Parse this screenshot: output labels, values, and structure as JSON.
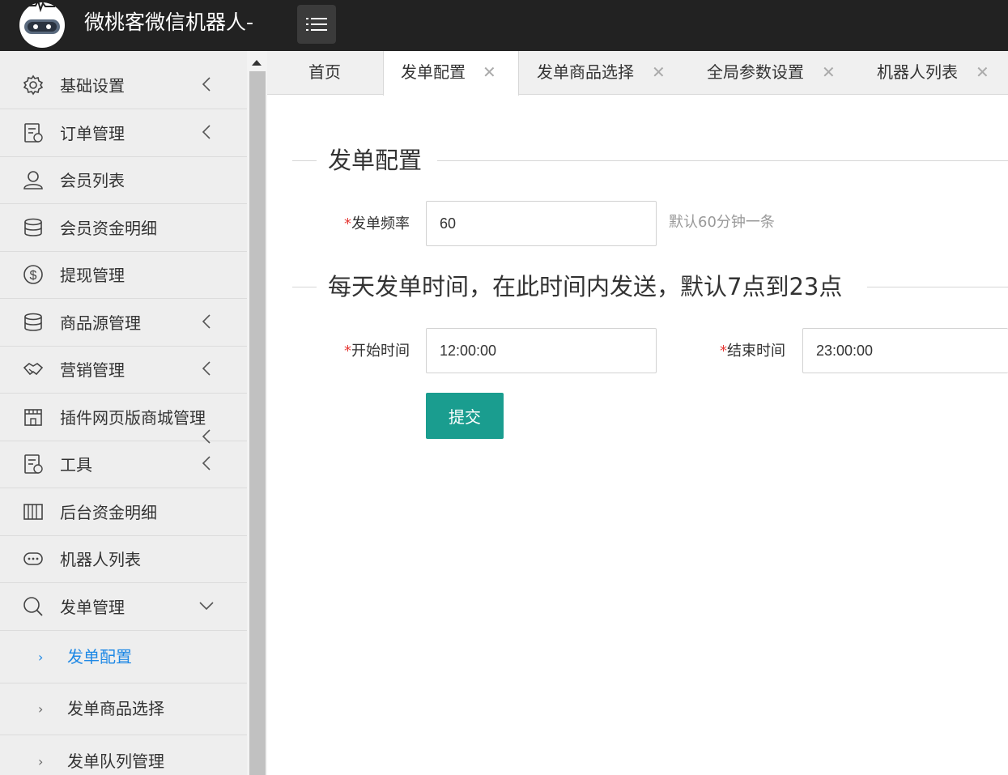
{
  "header": {
    "app_title": "微桃客微信机器人-",
    "logo_icon": "robot-icon",
    "menu_icon": "list-menu-icon"
  },
  "sidebar": {
    "items": [
      {
        "label": "基础设置",
        "icon": "gear-icon",
        "expand": "left"
      },
      {
        "label": "订单管理",
        "icon": "order-icon",
        "expand": "left"
      },
      {
        "label": "会员列表",
        "icon": "user-icon",
        "expand": ""
      },
      {
        "label": "会员资金明细",
        "icon": "database-icon",
        "expand": ""
      },
      {
        "label": "提现管理",
        "icon": "dollar-icon",
        "expand": ""
      },
      {
        "label": "商品源管理",
        "icon": "database-icon",
        "expand": "left"
      },
      {
        "label": "营销管理",
        "icon": "handshake-icon",
        "expand": "left"
      },
      {
        "label": "插件网页版商城管理",
        "icon": "store-icon",
        "expand": "left"
      },
      {
        "label": "工具",
        "icon": "order-icon",
        "expand": "left"
      },
      {
        "label": "后台资金明细",
        "icon": "columns-icon",
        "expand": ""
      },
      {
        "label": "机器人列表",
        "icon": "chat-icon",
        "expand": ""
      },
      {
        "label": "发单管理",
        "icon": "search-icon",
        "expand": "down"
      }
    ],
    "sub_items": [
      {
        "label": "发单配置",
        "active": true
      },
      {
        "label": "发单商品选择",
        "active": false
      },
      {
        "label": "发单队列管理",
        "active": false
      }
    ]
  },
  "tabs": [
    {
      "label": "首页",
      "closable": false,
      "active": false
    },
    {
      "label": "发单配置",
      "closable": true,
      "active": true
    },
    {
      "label": "发单商品选择",
      "closable": true,
      "active": false
    },
    {
      "label": "全局参数设置",
      "closable": true,
      "active": false
    },
    {
      "label": "机器人列表",
      "closable": true,
      "active": false
    }
  ],
  "close_glyph": "✕",
  "form": {
    "section1_title": "发单配置",
    "frequency_label": "发单频率",
    "frequency_value": "60",
    "frequency_hint": "默认60分钟一条",
    "section2_title": "每天发单时间，在此时间内发送，默认7点到23点",
    "start_label": "开始时间",
    "start_value": "12:00:00",
    "end_label": "结束时间",
    "end_value": "23:00:00",
    "required_mark": "*",
    "submit_label": "提交"
  },
  "colors": {
    "header_bg": "#222222",
    "sidebar_bg": "#eeeeee",
    "active_link": "#1e88e5",
    "submit_bg": "#1a9d8f",
    "required": "#e53935"
  }
}
